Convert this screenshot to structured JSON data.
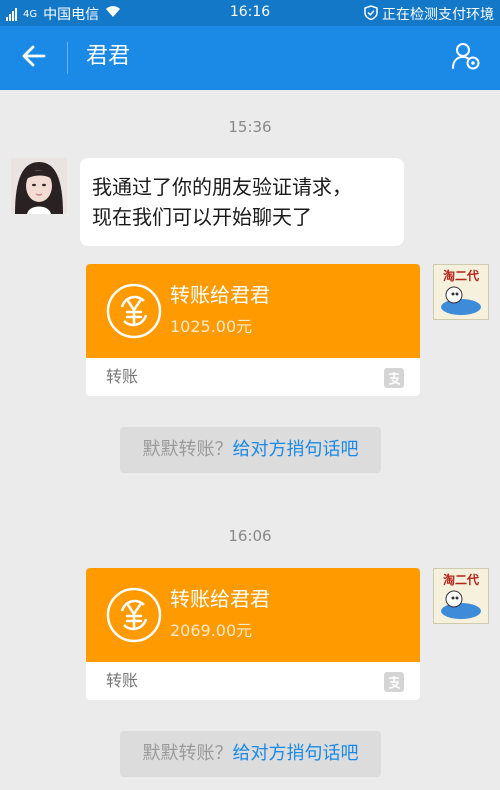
{
  "status_bar": {
    "network": "4G",
    "carrier": "中国电信",
    "time": "16:16",
    "security_text": "正在检测支付环境"
  },
  "header": {
    "title": "君君",
    "icons": {
      "back": "arrow-left-icon",
      "profile": "user-settings-icon"
    }
  },
  "messages": [
    {
      "type": "time",
      "text": "15:36"
    },
    {
      "type": "text",
      "sender": "contact",
      "lines": [
        "我通过了你的朋友验证请求，",
        "现在我们可以开始聊天了"
      ]
    },
    {
      "type": "transfer",
      "sender": "me",
      "title": "转账给君君",
      "amount": "1025.00元",
      "label": "转账"
    },
    {
      "type": "hint",
      "gray": "默默转账？",
      "link": "给对方捎句话吧"
    },
    {
      "type": "time",
      "text": "16:06"
    },
    {
      "type": "transfer",
      "sender": "me",
      "title": "转账给君君",
      "amount": "2069.00元",
      "label": "转账"
    },
    {
      "type": "hint",
      "gray": "默默转账？",
      "link": "给对方捎句话吧"
    }
  ],
  "my_avatar_text": "淘二代",
  "colors": {
    "status_bar": "#1378c8",
    "header": "#1a8ae6",
    "background": "#ebebeb",
    "transfer_orange": "#ff9a00",
    "link_blue": "#1a8ae6"
  }
}
